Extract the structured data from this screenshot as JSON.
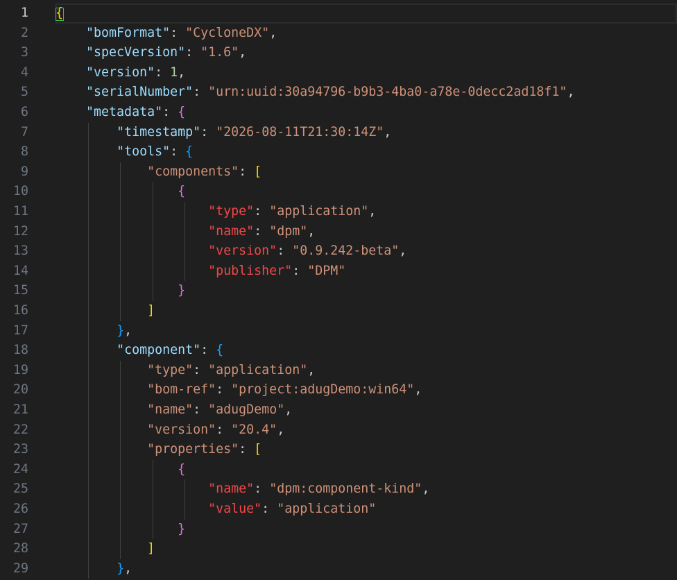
{
  "editor": {
    "language": "json",
    "current_line": 1,
    "colors": {
      "background": "#1f1f1f",
      "key": "#9cdcfe",
      "string": "#ce9178",
      "number": "#b5cea8",
      "bracket_level1": "#ffd700",
      "bracket_level2": "#da70d6",
      "bracket_level3": "#179fff"
    },
    "lines": [
      {
        "n": "1",
        "indent": 0,
        "tokens": [
          [
            "b1",
            "{"
          ]
        ]
      },
      {
        "n": "2",
        "indent": 1,
        "tokens": [
          [
            "key",
            "\"bomFormat\""
          ],
          [
            "punct",
            ": "
          ],
          [
            "str",
            "\"CycloneDX\""
          ],
          [
            "punct",
            ","
          ]
        ]
      },
      {
        "n": "3",
        "indent": 1,
        "tokens": [
          [
            "key",
            "\"specVersion\""
          ],
          [
            "punct",
            ": "
          ],
          [
            "str",
            "\"1.6\""
          ],
          [
            "punct",
            ","
          ]
        ]
      },
      {
        "n": "4",
        "indent": 1,
        "tokens": [
          [
            "key",
            "\"version\""
          ],
          [
            "punct",
            ": "
          ],
          [
            "num",
            "1"
          ],
          [
            "punct",
            ","
          ]
        ]
      },
      {
        "n": "5",
        "indent": 1,
        "tokens": [
          [
            "key",
            "\"serialNumber\""
          ],
          [
            "punct",
            ": "
          ],
          [
            "str",
            "\"urn:uuid:30a94796-b9b3-4ba0-a78e-0decc2ad18f1\""
          ],
          [
            "punct",
            ","
          ]
        ]
      },
      {
        "n": "6",
        "indent": 1,
        "tokens": [
          [
            "key",
            "\"metadata\""
          ],
          [
            "punct",
            ": "
          ],
          [
            "b2",
            "{"
          ]
        ]
      },
      {
        "n": "7",
        "indent": 2,
        "tokens": [
          [
            "key",
            "\"timestamp\""
          ],
          [
            "punct",
            ": "
          ],
          [
            "str",
            "\"2026-08-11T21:30:14Z\""
          ],
          [
            "punct",
            ","
          ]
        ]
      },
      {
        "n": "8",
        "indent": 2,
        "tokens": [
          [
            "key",
            "\"tools\""
          ],
          [
            "punct",
            ": "
          ],
          [
            "b3",
            "{"
          ]
        ]
      },
      {
        "n": "9",
        "indent": 3,
        "tokens": [
          [
            "key2",
            "\"components\""
          ],
          [
            "punct",
            ": "
          ],
          [
            "b1",
            "["
          ]
        ]
      },
      {
        "n": "10",
        "indent": 4,
        "tokens": [
          [
            "b2",
            "{"
          ]
        ]
      },
      {
        "n": "11",
        "indent": 5,
        "tokens": [
          [
            "key3",
            "\"type\""
          ],
          [
            "punct",
            ": "
          ],
          [
            "str",
            "\"application\""
          ],
          [
            "punct",
            ","
          ]
        ]
      },
      {
        "n": "12",
        "indent": 5,
        "tokens": [
          [
            "key3",
            "\"name\""
          ],
          [
            "punct",
            ": "
          ],
          [
            "str",
            "\"dpm\""
          ],
          [
            "punct",
            ","
          ]
        ]
      },
      {
        "n": "13",
        "indent": 5,
        "tokens": [
          [
            "key3",
            "\"version\""
          ],
          [
            "punct",
            ": "
          ],
          [
            "str",
            "\"0.9.242-beta\""
          ],
          [
            "punct",
            ","
          ]
        ]
      },
      {
        "n": "14",
        "indent": 5,
        "tokens": [
          [
            "key3",
            "\"publisher\""
          ],
          [
            "punct",
            ": "
          ],
          [
            "str",
            "\"DPM\""
          ]
        ]
      },
      {
        "n": "15",
        "indent": 4,
        "tokens": [
          [
            "b2",
            "}"
          ]
        ]
      },
      {
        "n": "16",
        "indent": 3,
        "tokens": [
          [
            "b1",
            "]"
          ]
        ]
      },
      {
        "n": "17",
        "indent": 2,
        "tokens": [
          [
            "b3",
            "}"
          ],
          [
            "punct",
            ","
          ]
        ]
      },
      {
        "n": "18",
        "indent": 2,
        "tokens": [
          [
            "key",
            "\"component\""
          ],
          [
            "punct",
            ": "
          ],
          [
            "b3",
            "{"
          ]
        ]
      },
      {
        "n": "19",
        "indent": 3,
        "tokens": [
          [
            "key2",
            "\"type\""
          ],
          [
            "punct",
            ": "
          ],
          [
            "str",
            "\"application\""
          ],
          [
            "punct",
            ","
          ]
        ]
      },
      {
        "n": "20",
        "indent": 3,
        "tokens": [
          [
            "key2",
            "\"bom-ref\""
          ],
          [
            "punct",
            ": "
          ],
          [
            "str",
            "\"project:adugDemo:win64\""
          ],
          [
            "punct",
            ","
          ]
        ]
      },
      {
        "n": "21",
        "indent": 3,
        "tokens": [
          [
            "key2",
            "\"name\""
          ],
          [
            "punct",
            ": "
          ],
          [
            "str",
            "\"adugDemo\""
          ],
          [
            "punct",
            ","
          ]
        ]
      },
      {
        "n": "22",
        "indent": 3,
        "tokens": [
          [
            "key2",
            "\"version\""
          ],
          [
            "punct",
            ": "
          ],
          [
            "str",
            "\"20.4\""
          ],
          [
            "punct",
            ","
          ]
        ]
      },
      {
        "n": "23",
        "indent": 3,
        "tokens": [
          [
            "key2",
            "\"properties\""
          ],
          [
            "punct",
            ": "
          ],
          [
            "b1",
            "["
          ]
        ]
      },
      {
        "n": "24",
        "indent": 4,
        "tokens": [
          [
            "b2",
            "{"
          ]
        ]
      },
      {
        "n": "25",
        "indent": 5,
        "tokens": [
          [
            "key3",
            "\"name\""
          ],
          [
            "punct",
            ": "
          ],
          [
            "str",
            "\"dpm:component-kind\""
          ],
          [
            "punct",
            ","
          ]
        ]
      },
      {
        "n": "26",
        "indent": 5,
        "tokens": [
          [
            "key3",
            "\"value\""
          ],
          [
            "punct",
            ": "
          ],
          [
            "str",
            "\"application\""
          ]
        ]
      },
      {
        "n": "27",
        "indent": 4,
        "tokens": [
          [
            "b2",
            "}"
          ]
        ]
      },
      {
        "n": "28",
        "indent": 3,
        "tokens": [
          [
            "b1",
            "]"
          ]
        ]
      },
      {
        "n": "29",
        "indent": 2,
        "tokens": [
          [
            "b3",
            "}"
          ],
          [
            "punct",
            ","
          ]
        ]
      }
    ]
  }
}
